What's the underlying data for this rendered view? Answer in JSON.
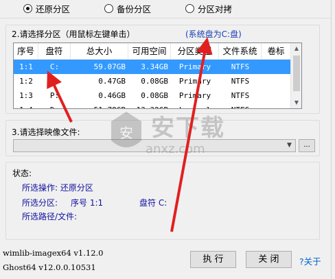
{
  "modes": [
    {
      "label": "还原分区",
      "selected": true
    },
    {
      "label": "备份分区",
      "selected": false
    },
    {
      "label": "分区对拷",
      "selected": false
    }
  ],
  "section2": {
    "title": "2.请选择分区（用鼠标左键单击）",
    "system_disk_note": "(系统盘为C:盘)"
  },
  "table": {
    "columns": [
      "序号",
      "盘符",
      "总大小",
      "可用空间",
      "分区类型",
      "文件系统",
      "卷标"
    ],
    "rows": [
      [
        "1:1",
        "C:",
        "59.07GB",
        "3.34GB",
        "Primary",
        "NTFS",
        ""
      ],
      [
        "1:2",
        "F:",
        "0.47GB",
        "0.08GB",
        "Primary",
        "NTFS",
        ""
      ],
      [
        "1:3",
        "P:",
        "0.46GB",
        "0.08GB",
        "Primary",
        "NTFS",
        ""
      ],
      [
        "1:4",
        "D:",
        "51.78GB",
        "13.32GB",
        "Logical",
        "NTFS",
        ""
      ]
    ],
    "selected_row": 0
  },
  "section3": {
    "title": "3.请选择映像文件:",
    "file_value": "",
    "browse_label": "..."
  },
  "status": {
    "label": "状态:",
    "operation": "所选操作: 还原分区",
    "partition_prefix": "所选分区:",
    "partition_index": "序号 1:1",
    "partition_drive": "盘符 C:",
    "path": "所选路径/文件:"
  },
  "footer": {
    "wimlib": "wimlib-imagex64 v1.12.0",
    "ghost": "Ghost64 v12.0.0.10531",
    "execute_label": "执 行",
    "close_label": "关 闭",
    "about_label": "?关于"
  },
  "watermark": {
    "text": "安下载",
    "sub": "anxz.com"
  },
  "colors": {
    "selection": "#3399ff",
    "arrow": "#e02020",
    "link": "#0066cc",
    "status_text": "#1010a0"
  }
}
